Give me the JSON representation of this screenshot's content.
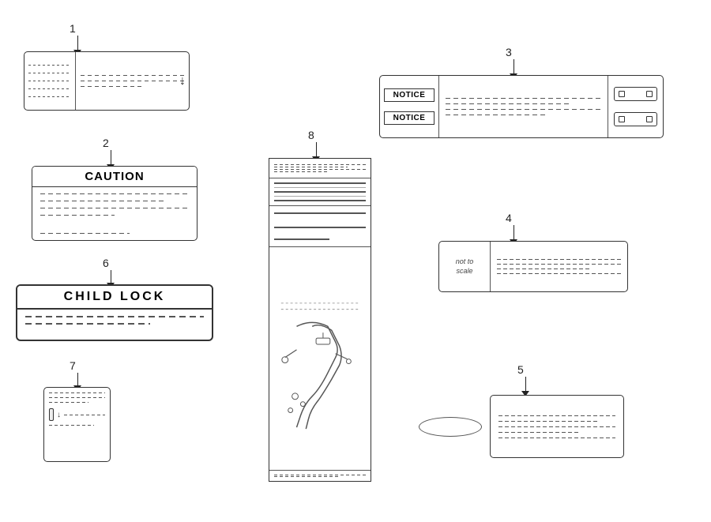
{
  "labels": {
    "label1": {
      "number": "1",
      "description": "Horizontal label with scroll arrow"
    },
    "label2": {
      "number": "2",
      "header": "CAUTION",
      "description": "Caution label with dashed lines"
    },
    "label3": {
      "number": "3",
      "notice1": "NOTICE",
      "notice2": "NOTICE",
      "description": "Notice label with connectors"
    },
    "label4": {
      "number": "4",
      "left_text": "not to\nscale",
      "description": "Label with icon and dashes"
    },
    "label5": {
      "number": "5",
      "description": "Label with oval"
    },
    "label6": {
      "number": "6",
      "header": "CHILD  LOCK",
      "description": "Child lock label"
    },
    "label7": {
      "number": "7",
      "description": "Small square label"
    },
    "label8": {
      "number": "8",
      "description": "Tall vertical label with diagram"
    }
  }
}
